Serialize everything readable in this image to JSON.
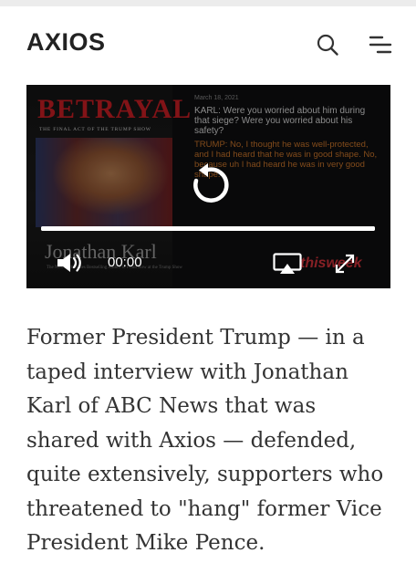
{
  "header": {
    "logo_text": "AXIOS",
    "search_icon": "search-icon",
    "menu_icon": "menu-icon"
  },
  "video": {
    "book": {
      "title": "BETRAYAL",
      "subtitle": "The Final Act of the Trump Show",
      "author": "Jonathan Karl",
      "footer": "The New York Times Bestselling Author of Front Row at the Trump Show"
    },
    "transcript": {
      "date": "March 18, 2021",
      "question": "KARL: Were you worried about him during that siege? Were you worried about his safety?",
      "answer": "TRUMP: No, I thought he was well-protected, and I had heard that he was in good shape. No, because uh I had heard he was in very good shape."
    },
    "watermark": "thisweek",
    "progress": 1.0,
    "time": "00:00",
    "icons": [
      "replay-icon",
      "volume-icon",
      "airplay-icon",
      "fullscreen-icon"
    ],
    "accent_color": "#c8742a"
  },
  "article": {
    "paragraph": "Former President Trump — in a taped interview with Jonathan Karl of ABC News that was shared with Axios — defended, quite extensively, supporters who threatened to \"hang\" former Vice President Mike Pence."
  }
}
